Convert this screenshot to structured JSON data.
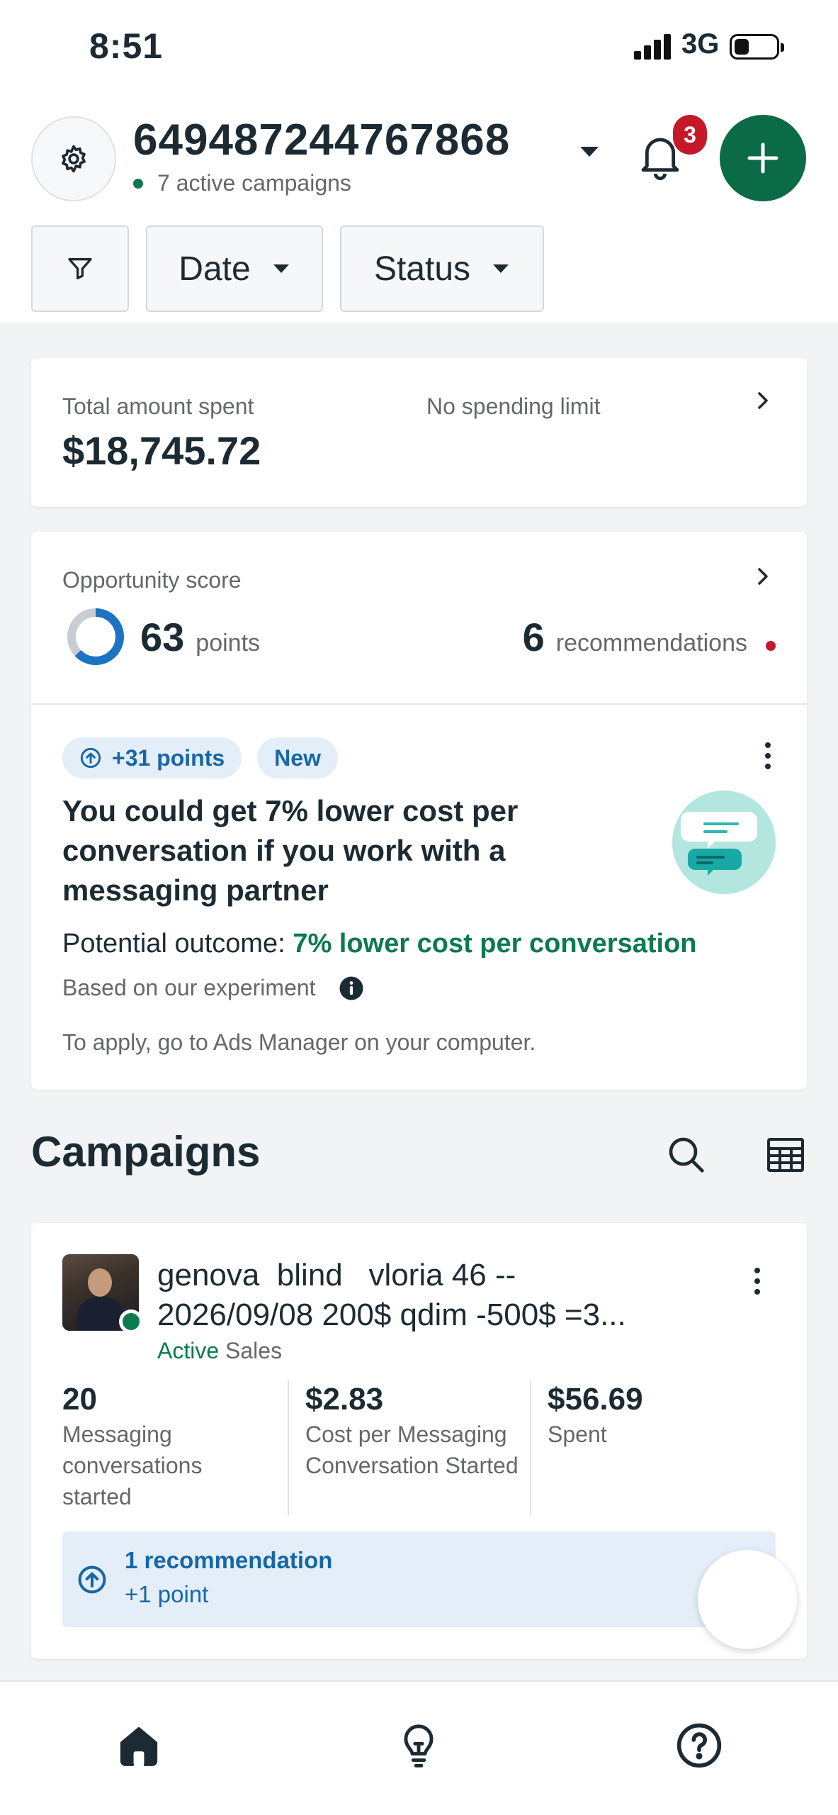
{
  "status_bar": {
    "time": "8:51",
    "network": "3G"
  },
  "header": {
    "account_id": "649487244767868",
    "active_campaigns": "7 active campaigns",
    "notification_count": "3"
  },
  "filters": {
    "date_label": "Date",
    "status_label": "Status"
  },
  "spend_card": {
    "label": "Total amount spent",
    "amount": "$18,745.72",
    "limit_text": "No spending limit"
  },
  "opportunity": {
    "label": "Opportunity score",
    "score": "63",
    "score_unit": "points",
    "score_fraction": 0.63,
    "recommendations_count": "6",
    "recommendations_label": "recommendations",
    "recommendation": {
      "points_pill": "+31 points",
      "new_pill": "New",
      "title": "You could get 7% lower cost per conversation if you work with a messaging partner",
      "outcome_label": "Potential outcome:",
      "outcome_value": "7% lower cost per conversation",
      "basis": "Based on our experiment",
      "apply_text": "To apply, go to Ads Manager on your computer."
    }
  },
  "campaigns": {
    "heading": "Campaigns",
    "items": [
      {
        "name": "genova  blind   vloria 46 --\n2026/09/08 200$ qdim -500$ =3...",
        "status": "Active",
        "objective": "Sales",
        "metrics": [
          {
            "value": "20",
            "label": "Messaging conversations started"
          },
          {
            "value": "$2.83",
            "label": "Cost per Messaging Conversation Started"
          },
          {
            "value": "$56.69",
            "label": "Spent"
          }
        ],
        "recommendation": {
          "title": "1 recommendation",
          "points": "+1 point"
        }
      }
    ]
  },
  "colors": {
    "brand_green": "#0b6b46",
    "active_green": "#0b7a4e",
    "link_blue": "#1767a6",
    "badge_red": "#c41a28",
    "score_blue": "#1c73c4"
  }
}
